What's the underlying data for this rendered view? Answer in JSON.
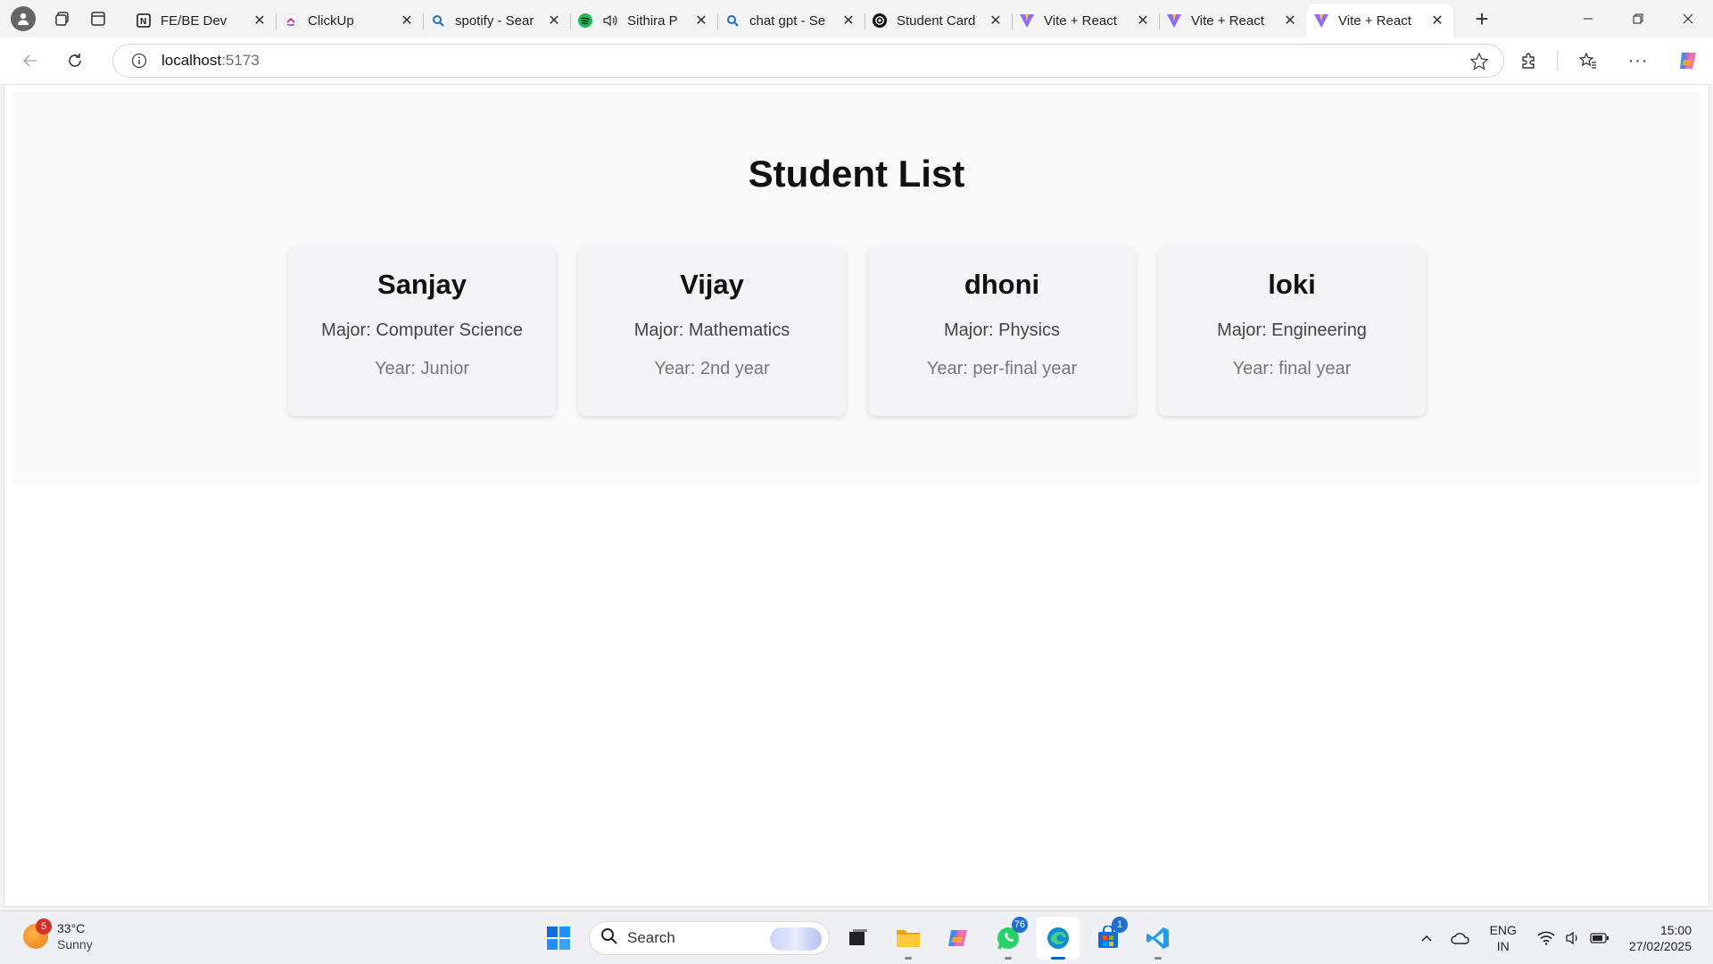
{
  "browser": {
    "tabs": [
      {
        "title": "FE/BE Dev",
        "favicon": "notion-icon"
      },
      {
        "title": "ClickUp",
        "favicon": "clickup-icon"
      },
      {
        "title": "spotify - Sear",
        "favicon": "search-icon"
      },
      {
        "title": "Sithira P",
        "favicon": "spotify-icon"
      },
      {
        "title": "chat gpt - Se",
        "favicon": "search-icon"
      },
      {
        "title": "Student Card",
        "favicon": "openai-icon"
      },
      {
        "title": "Vite + React",
        "favicon": "vite-icon"
      },
      {
        "title": "Vite + React",
        "favicon": "vite-icon"
      },
      {
        "title": "Vite + React",
        "favicon": "vite-icon"
      }
    ],
    "address": {
      "host": "localhost",
      "port": ":5173"
    }
  },
  "page": {
    "title": "Student List",
    "students": [
      {
        "name": "Sanjay",
        "major": "Major: Computer Science",
        "year": "Year: Junior"
      },
      {
        "name": "Vijay",
        "major": "Major: Mathematics",
        "year": "Year: 2nd year"
      },
      {
        "name": "dhoni",
        "major": "Major: Physics",
        "year": "Year: per-final year"
      },
      {
        "name": "loki",
        "major": "Major: Engineering",
        "year": "Year: final year"
      }
    ]
  },
  "taskbar": {
    "weather": {
      "temp": "33°C",
      "condition": "Sunny",
      "badge": "5"
    },
    "search_label": "Search",
    "whatsapp_badge": "76",
    "store_badge": "1",
    "language": {
      "line1": "ENG",
      "line2": "IN"
    },
    "clock": {
      "time": "15:00",
      "date": "27/02/2025"
    }
  }
}
